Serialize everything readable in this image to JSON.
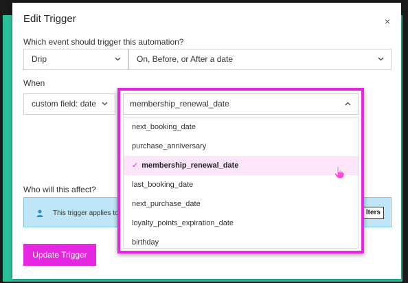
{
  "modal": {
    "title": "Edit Trigger",
    "close_glyph": "×"
  },
  "event_section": {
    "label": "Which event should trigger this automation?",
    "event_select_value": "Drip",
    "timing_select_value": "On, Before, or After a date"
  },
  "when_section": {
    "label": "When",
    "field_select_value": "custom field: date",
    "date_field_select_value": "membership_renewal_date"
  },
  "dropdown": {
    "options": [
      {
        "label": "next_booking_date",
        "selected": false
      },
      {
        "label": "purchase_anniversary",
        "selected": false
      },
      {
        "label": "membership_renewal_date",
        "selected": true
      },
      {
        "label": "last_booking_date",
        "selected": false
      },
      {
        "label": "next_purchase_date",
        "selected": false
      },
      {
        "label": "loyalty_points_expiration_date",
        "selected": false
      },
      {
        "label": "birthday",
        "selected": false
      }
    ],
    "check_glyph": "✓"
  },
  "audience_section": {
    "label": "Who will this affect?",
    "banner_text": "This trigger applies to",
    "filters_button_label": "lters"
  },
  "footer": {
    "update_button_label": "Update Trigger"
  },
  "colors": {
    "accent": "#e627e2",
    "teal_backdrop": "#2bbf9a",
    "info_banner": "#bfe6f7"
  },
  "icons": {
    "close": "close-icon",
    "chevron": "chevron-down-icon",
    "person": "person-icon",
    "pointer": "pointer-hand-icon"
  }
}
